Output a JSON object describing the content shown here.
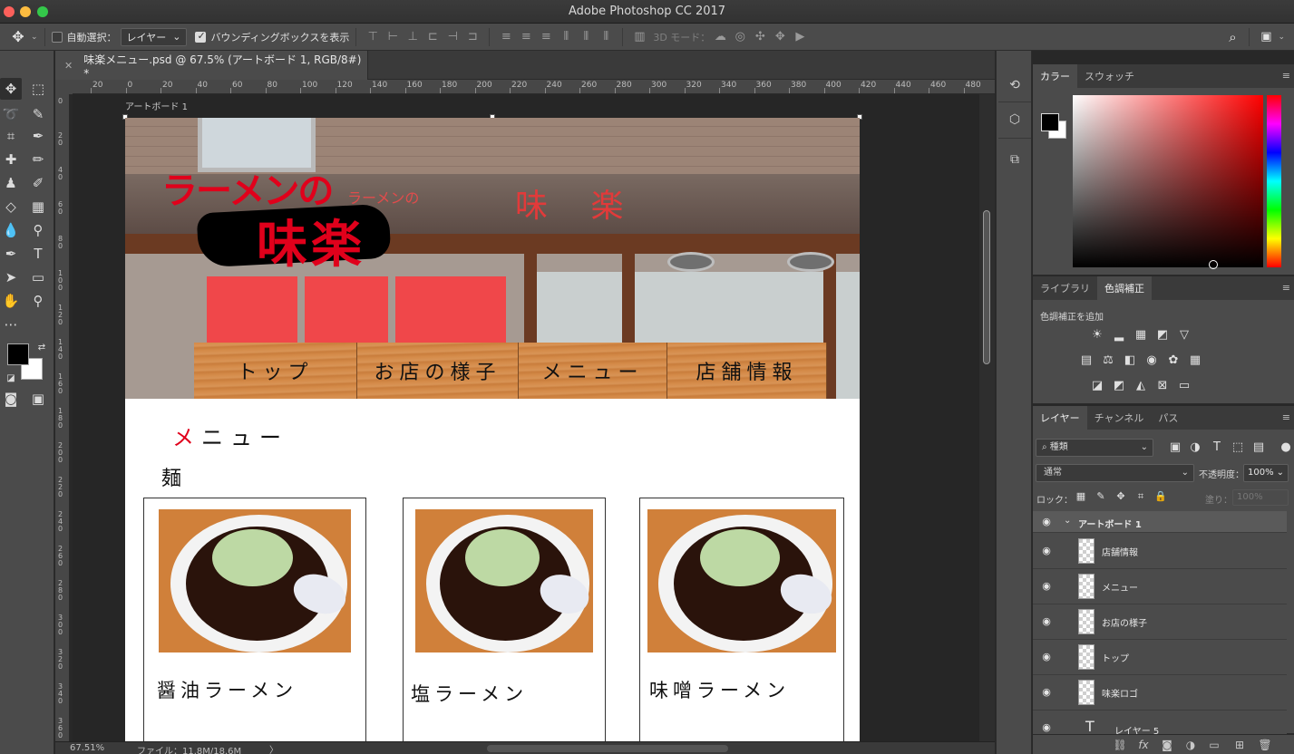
{
  "window": {
    "title": "Adobe Photoshop CC 2017"
  },
  "options_bar": {
    "auto_select_label": "自動選択：",
    "auto_select_value": "レイヤー",
    "bbox_label": "バウンディングボックスを表示",
    "mode3d_label": "3D モード："
  },
  "document_tab": {
    "title": "味楽メニュー.psd @ 67.5% (アートボード 1, RGB/8#) *"
  },
  "ruler": {
    "h_labels": [
      "20",
      "0",
      "20",
      "40",
      "60",
      "80",
      "100",
      "120",
      "140",
      "160",
      "180",
      "200",
      "220",
      "240",
      "260",
      "280",
      "300",
      "320",
      "340",
      "360",
      "380",
      "400",
      "420",
      "440",
      "460",
      "480"
    ],
    "v_labels": [
      "0",
      "20",
      "40",
      "60",
      "80",
      "100",
      "120",
      "140",
      "160",
      "180",
      "200",
      "220",
      "240",
      "260",
      "280",
      "300",
      "320",
      "340",
      "360",
      "380"
    ]
  },
  "artboard": {
    "label": "アートボード 1",
    "logo_top": "ラーメンの",
    "logo_main": "味楽",
    "sign_text": "味 楽",
    "sign_small": "ラーメンの",
    "nav": [
      "トップ",
      "お店の様子",
      "メニュー",
      "店舗情報"
    ],
    "menu_title_first": "メ",
    "menu_title_rest": "ニュー",
    "section": "麺",
    "cards": [
      "醤油ラーメン",
      "塩ラーメン",
      "味噌ラーメン"
    ]
  },
  "status": {
    "zoom": "67.51%",
    "file": "ファイル：11.8M/18.6M",
    "arrow": "〉"
  },
  "color_panel": {
    "tabs": [
      "カラー",
      "スウォッチ"
    ],
    "fg": "#000000",
    "bg": "#ffffff",
    "hue": "#ff0000"
  },
  "adjust_panel": {
    "tabs": [
      "ライブラリ",
      "色調補正"
    ],
    "add_label": "色調補正を追加"
  },
  "layers_panel": {
    "tabs": [
      "レイヤー",
      "チャンネル",
      "パス"
    ],
    "filter": "種類",
    "blend_mode": "通常",
    "opacity_label": "不透明度：",
    "opacity": "100%",
    "lock_label": "ロック：",
    "fill_label": "塗り：",
    "fill": "100%",
    "group": "アートボード 1",
    "layers": [
      "店舗情報",
      "メニュー",
      "お店の様子",
      "トップ",
      "味楽ロゴ",
      "レイヤー 5"
    ]
  },
  "colors": {
    "accent_red": "#e0001b",
    "ui_bg": "#4b4b4b",
    "panel_dark": "#3a3a3a"
  }
}
